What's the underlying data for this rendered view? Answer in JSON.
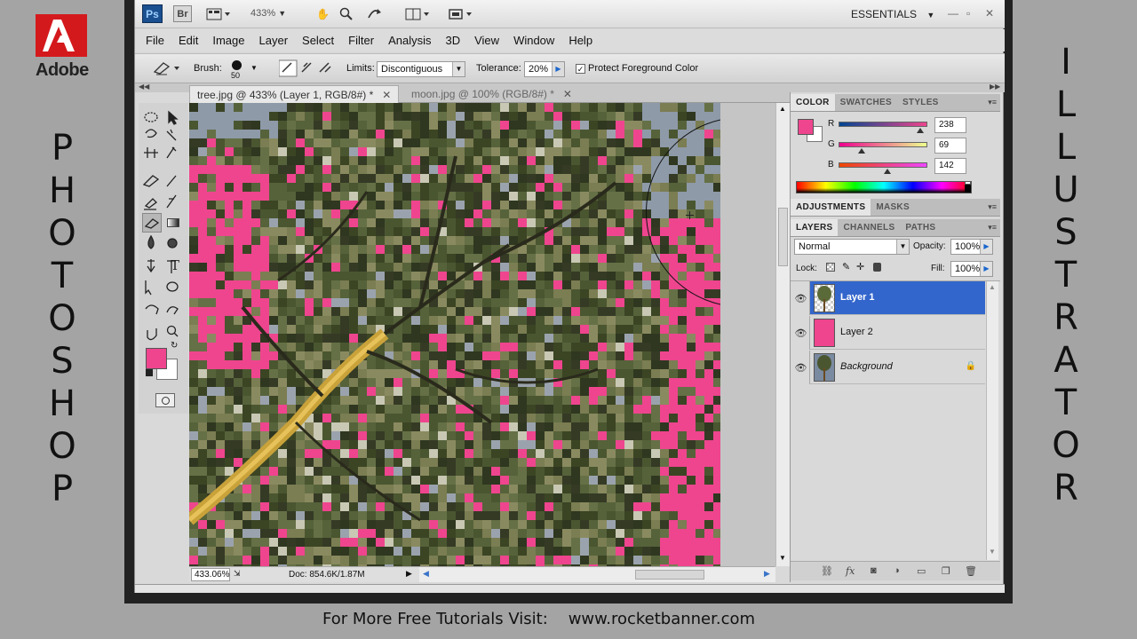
{
  "branding": {
    "adobe": "Adobe",
    "left_word": [
      "P",
      "H",
      "O",
      "T",
      "O",
      "S",
      "H",
      "O",
      "P"
    ],
    "right_word": [
      "I",
      "L",
      "L",
      "U",
      "S",
      "T",
      "R",
      "A",
      "T",
      "O",
      "R"
    ],
    "footer_label": "For More Free Tutorials Visit:",
    "footer_url": "www.rocketbanner.com"
  },
  "titlebar": {
    "ps": "Ps",
    "br": "Br",
    "zoom": "433%",
    "workspace": "ESSENTIALS"
  },
  "menu": [
    "File",
    "Edit",
    "Image",
    "Layer",
    "Select",
    "Filter",
    "Analysis",
    "3D",
    "View",
    "Window",
    "Help"
  ],
  "options": {
    "brush_label": "Brush:",
    "brush_size": "50",
    "limits_label": "Limits:",
    "limits_value": "Discontiguous",
    "tolerance_label": "Tolerance:",
    "tolerance_value": "20%",
    "protect_label": "Protect Foreground Color",
    "protect_checked": "✓"
  },
  "tabs": [
    {
      "label": "tree.jpg @ 433% (Layer 1, RGB/8#) *",
      "active": true
    },
    {
      "label": "moon.jpg @ 100% (RGB/8#) *",
      "active": false
    }
  ],
  "status": {
    "zoom": "433.06%",
    "doc": "Doc: 854.6K/1.87M"
  },
  "color_panel": {
    "tabs": [
      "COLOR",
      "SWATCHES",
      "STYLES"
    ],
    "r_label": "R",
    "r": "238",
    "g_label": "G",
    "g": "69",
    "b_label": "B",
    "b": "142",
    "foreground": "#ee458e"
  },
  "adjust_panel": {
    "tabs": [
      "ADJUSTMENTS",
      "MASKS"
    ]
  },
  "layers_panel": {
    "tabs": [
      "LAYERS",
      "CHANNELS",
      "PATHS"
    ],
    "blend_mode": "Normal",
    "opacity_label": "Opacity:",
    "opacity": "100%",
    "lock_label": "Lock:",
    "fill_label": "Fill:",
    "fill": "100%",
    "layers": [
      {
        "name": "Layer 1",
        "selected": true
      },
      {
        "name": "Layer 2",
        "selected": false
      },
      {
        "name": "Background",
        "selected": false
      }
    ]
  }
}
